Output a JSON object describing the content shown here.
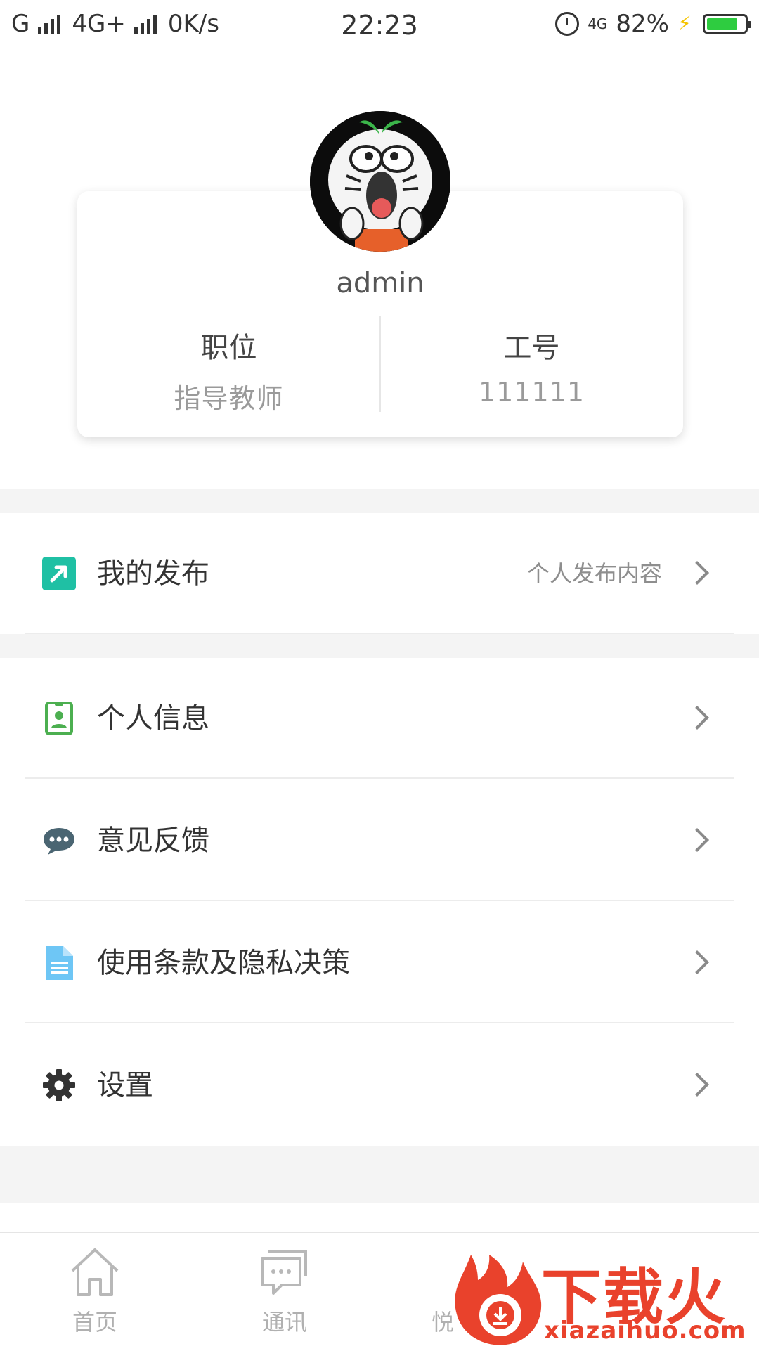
{
  "status_bar": {
    "carrier1": "G",
    "carrier2": "4G+",
    "speed": "0K/s",
    "time": "22:23",
    "network_badge": "4G",
    "battery_percent_text": "82%",
    "battery_level": 0.82
  },
  "profile": {
    "username": "admin",
    "position_label": "职位",
    "position_value": "指导教师",
    "id_label": "工号",
    "id_value": "111111"
  },
  "menu": {
    "publish": {
      "label": "我的发布",
      "hint": "个人发布内容",
      "icon": "external-link-icon",
      "color": "#1fc0a4"
    },
    "personal_info": {
      "label": "个人信息",
      "icon": "id-badge-icon",
      "color": "#4caf50"
    },
    "feedback": {
      "label": "意见反馈",
      "icon": "chat-bubble-icon",
      "color": "#4a6572"
    },
    "terms": {
      "label": "使用条款及隐私决策",
      "icon": "document-icon",
      "color": "#6ec6f5"
    },
    "settings": {
      "label": "设置",
      "icon": "gear-icon",
      "color": "#333333"
    }
  },
  "tabbar": {
    "home": "首页",
    "messages": "通讯",
    "third_partial": "悦"
  },
  "watermark": {
    "title": "下载火",
    "url": "xiazaihuo.com"
  }
}
